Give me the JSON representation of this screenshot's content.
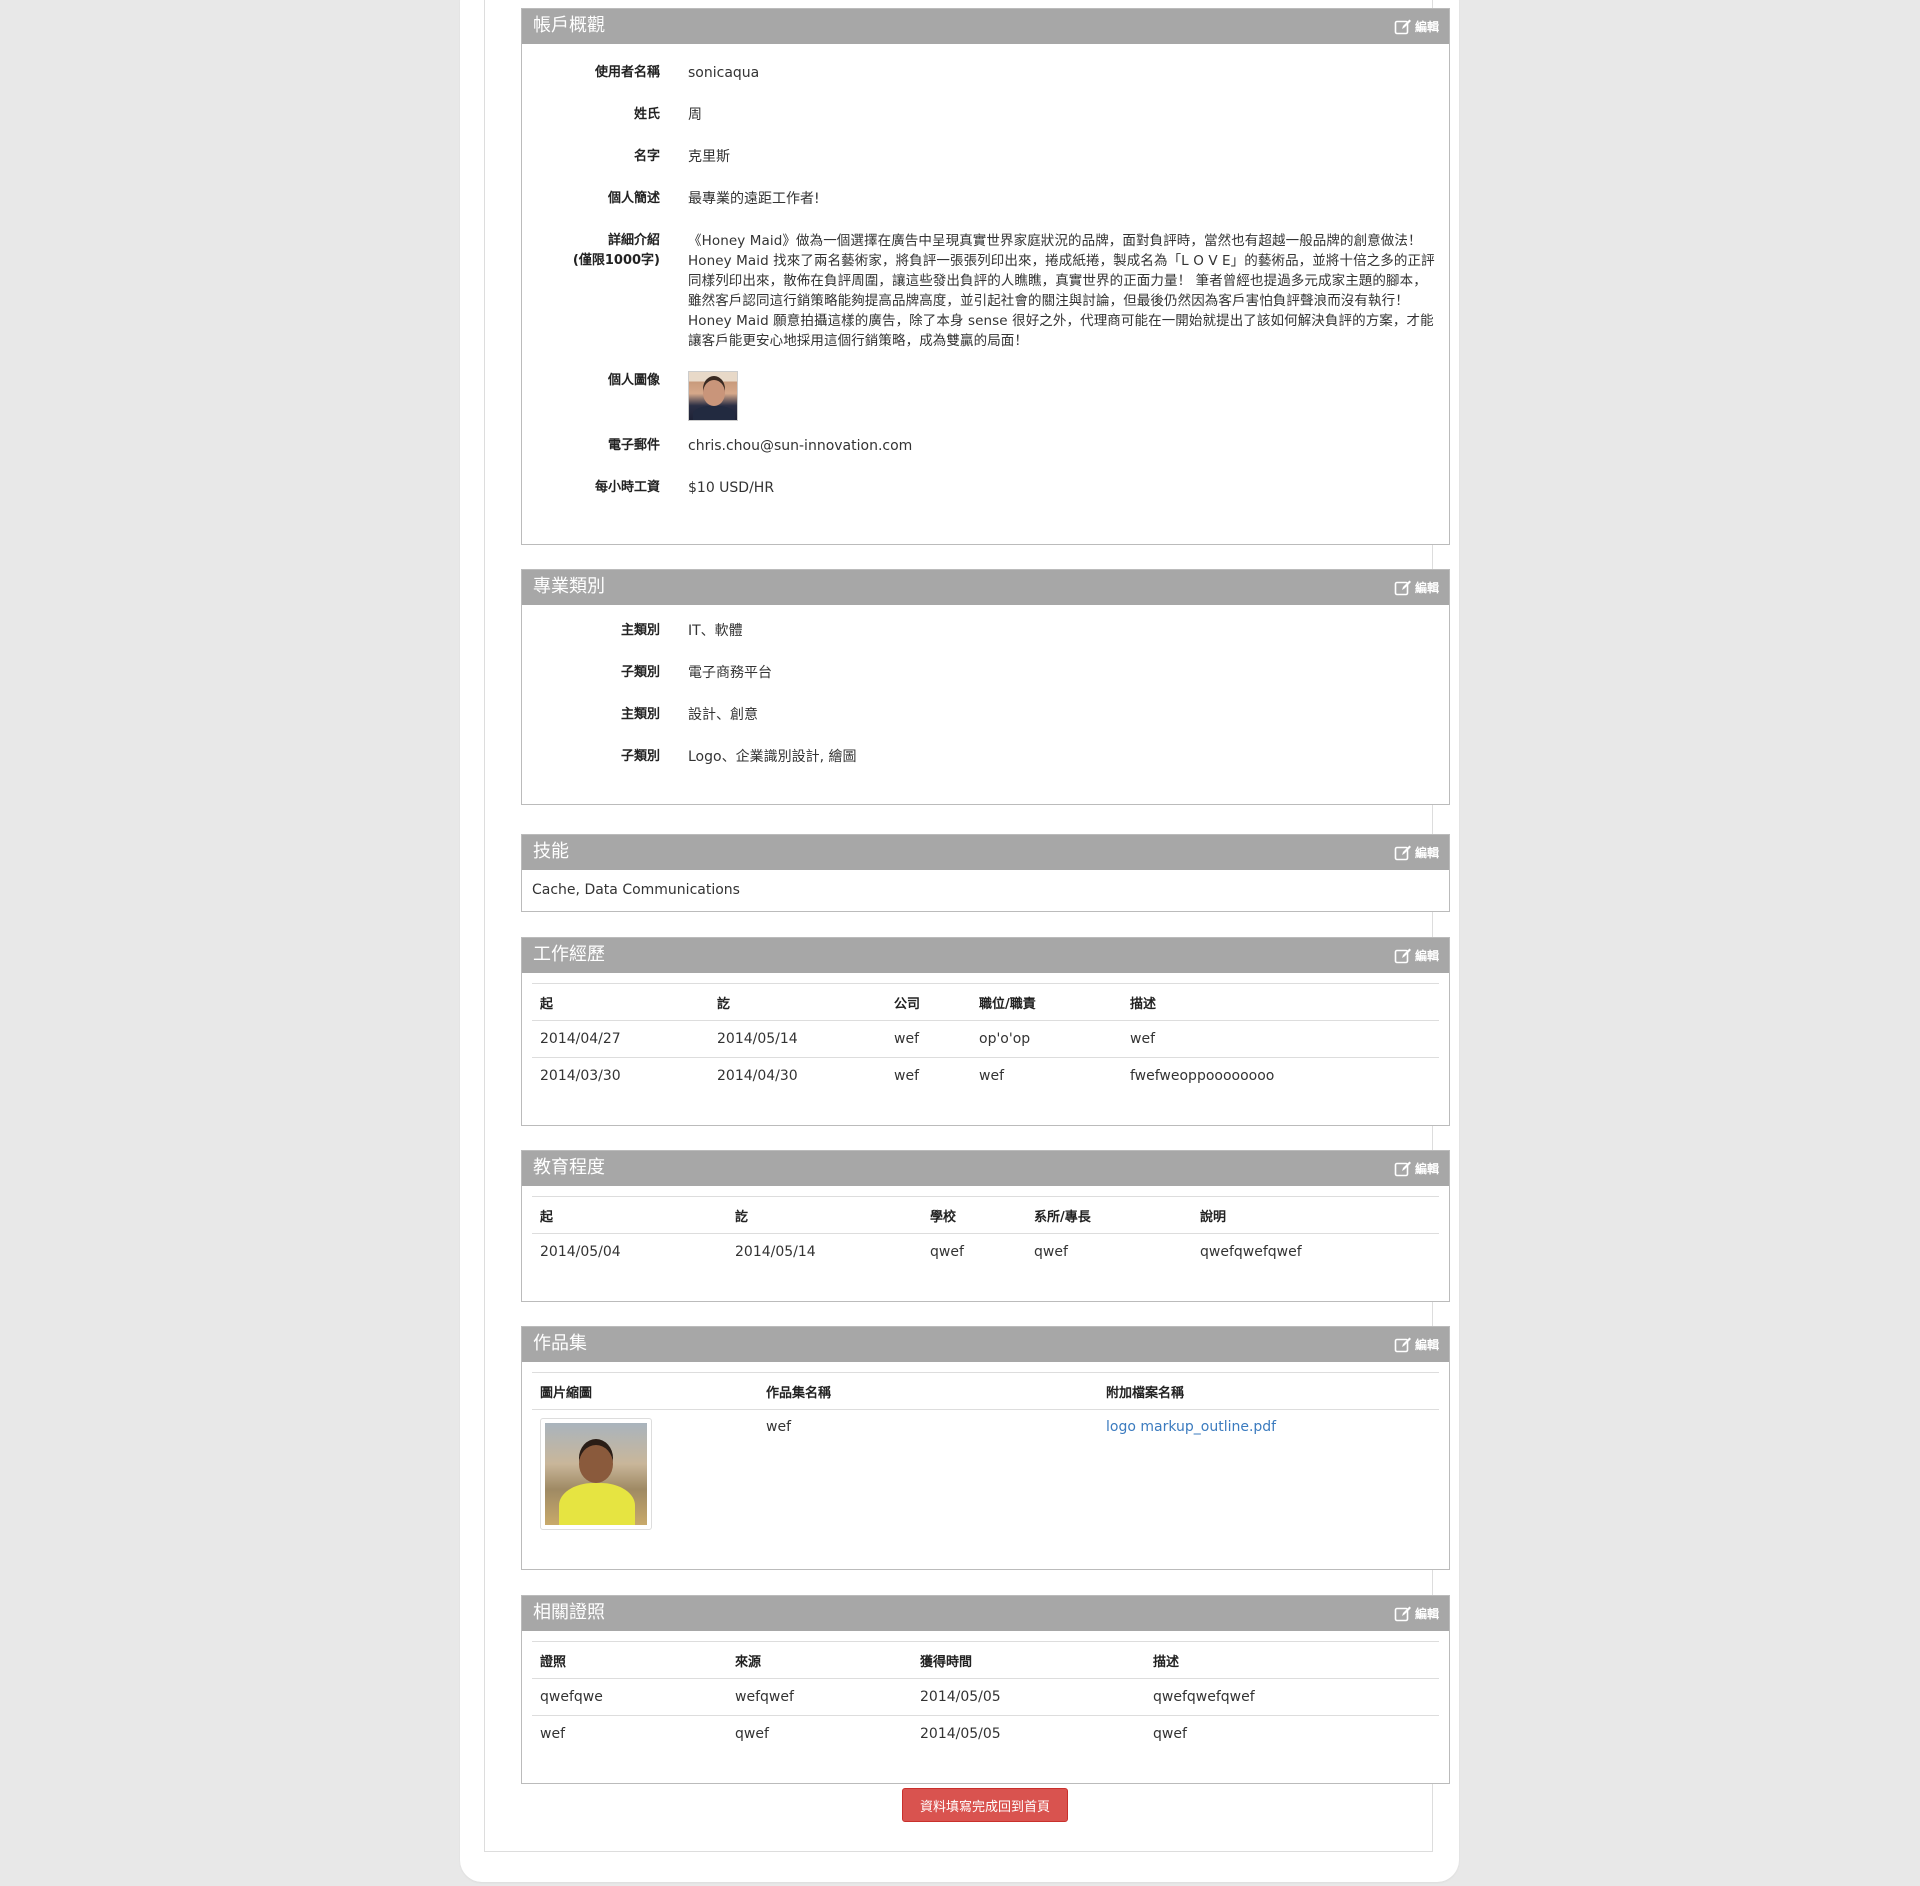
{
  "edit_label": "編輯",
  "account": {
    "title": "帳戶概觀",
    "fields": [
      {
        "label": "使用者名稱",
        "value": "sonicaqua"
      },
      {
        "label": "姓氏",
        "value": "周"
      },
      {
        "label": "名字",
        "value": "克里斯"
      },
      {
        "label": "個人簡述",
        "value": "最專業的遠距工作者!"
      },
      {
        "label": "詳細介紹\n(僅限1000字)",
        "value": "《Honey Maid》做為一個選擇在廣告中呈現真實世界家庭狀況的品牌，面對負評時，當然也有超越一般品牌的創意做法！Honey Maid 找來了兩名藝術家，將負評一張張列印出來，捲成紙捲，製成名為「L O V E」的藝術品，並將十倍之多的正評同樣列印出來，散佈在負評周圍，讓這些發出負評的人瞧瞧，真實世界的正面力量！ 筆者曾經也提過多元成家主題的腳本，雖然客戶認同這行銷策略能夠提高品牌高度，並引起社會的關注與討論，但最後仍然因為客戶害怕負評聲浪而沒有執行！Honey Maid 願意拍攝這樣的廣告，除了本身 sense 很好之外，代理商可能在一開始就提出了該如何解決負評的方案，才能讓客戶能更安心地採用這個行銷策略，成為雙贏的局面！"
      },
      {
        "label": "個人圖像",
        "value": ""
      },
      {
        "label": "電子郵件",
        "value": "chris.chou@sun-innovation.com"
      },
      {
        "label": "每小時工資",
        "value": "$10 USD/HR"
      }
    ]
  },
  "category": {
    "title": "專業類別",
    "fields": [
      {
        "label": "主類別",
        "value": "IT、軟體"
      },
      {
        "label": "子類別",
        "value": "電子商務平台"
      },
      {
        "label": "主類別",
        "value": "設計、創意"
      },
      {
        "label": "子類別",
        "value": "Logo、企業識別設計, 繪圖"
      }
    ]
  },
  "skills": {
    "title": "技能",
    "value": "Cache, Data Communications"
  },
  "work": {
    "title": "工作經歷",
    "headers": [
      "起",
      "訖",
      "公司",
      "職位/職責",
      "描述"
    ],
    "rows": [
      [
        "2014/04/27",
        "2014/05/14",
        "wef",
        "op'o'op",
        "wef"
      ],
      [
        "2014/03/30",
        "2014/04/30",
        "wef",
        "wef",
        "fwefweoppoooooooo"
      ]
    ]
  },
  "education": {
    "title": "教育程度",
    "headers": [
      "起",
      "訖",
      "學校",
      "系所/專長",
      "說明"
    ],
    "rows": [
      [
        "2014/05/04",
        "2014/05/14",
        "qwef",
        "qwef",
        "qwefqwefqwef"
      ]
    ]
  },
  "portfolio": {
    "title": "作品集",
    "headers": [
      "圖片縮圖",
      "作品集名稱",
      "附加檔案名稱"
    ],
    "rows": [
      {
        "name": "wef",
        "file": "logo markup_outline.pdf"
      }
    ]
  },
  "certs": {
    "title": "相關證照",
    "headers": [
      "證照",
      "來源",
      "獲得時間",
      "描述"
    ],
    "rows": [
      [
        "qwefqwe",
        "wefqwef",
        "2014/05/05",
        "qwefqwefqwef"
      ],
      [
        "wef",
        "qwef",
        "2014/05/05",
        "qwef"
      ]
    ]
  },
  "submit_label": "資料填寫完成回到首頁"
}
